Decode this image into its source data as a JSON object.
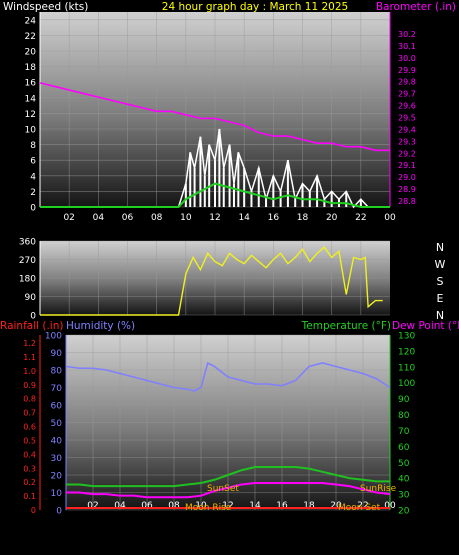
{
  "header": {
    "windspeed_label": "Windspeed (kts)",
    "title": "24 hour graph day : March 11 2025",
    "barometer_label": "Barometer (.in)"
  },
  "lower_header": {
    "rainfall_label": "Rainfall (.in)",
    "humidity_label": "Humidity (%)",
    "temperature_label": "Temperature (°F)",
    "dewpoint_label": "Dew Point (°F)"
  },
  "colors": {
    "windspeed": "#ffffff",
    "wind_avg": "#20d020",
    "barometer": "#ff00ff",
    "direction": "#f0f020",
    "humidity": "#8080ff",
    "temperature": "#20c020",
    "dewpoint": "#ff00ff",
    "rainfall": "#ff2020",
    "title": "#ffff00",
    "sun_moon": "#f0b000"
  },
  "x_ticks": [
    "02",
    "04",
    "06",
    "08",
    "10",
    "12",
    "14",
    "16",
    "18",
    "20",
    "22",
    "00"
  ],
  "compass_labels": [
    "N",
    "W",
    "S",
    "E",
    "N"
  ],
  "events": {
    "sunset": "SunSet",
    "sunrise": "SunRise",
    "moonrise": "Moon Rise",
    "moonset": "Moon Set"
  },
  "chart_data": [
    {
      "type": "line",
      "title": "24 hour graph day : March 11 2025",
      "xlim": [
        0,
        24
      ],
      "ylabel": "Windspeed (kts)",
      "ylim": [
        0,
        25
      ],
      "y_ticks": [
        0,
        2,
        4,
        6,
        8,
        10,
        12,
        14,
        16,
        18,
        20,
        22,
        24
      ],
      "y2label": "Barometer (.in)",
      "y2lim": [
        29.75,
        30.3
      ],
      "y2_ticks": [
        "28.8",
        "28.9",
        "29.0",
        "29.1",
        "29.2",
        "29.3",
        "29.4",
        "29.5",
        "29.6",
        "29.7",
        "29.8",
        "29.9",
        "30.0",
        "30.1",
        "30.2"
      ],
      "series": [
        {
          "name": "Barometer",
          "axis": "y2",
          "x": [
            0,
            1,
            2,
            3,
            4,
            5,
            6,
            7,
            8,
            9,
            10,
            11,
            12,
            13,
            14,
            15,
            16,
            17,
            18,
            19,
            20,
            21,
            22,
            23,
            24
          ],
          "values": [
            30.1,
            30.09,
            30.08,
            30.07,
            30.06,
            30.05,
            30.04,
            30.03,
            30.02,
            30.02,
            30.01,
            30.0,
            30.0,
            29.99,
            29.98,
            29.96,
            29.95,
            29.95,
            29.94,
            29.93,
            29.93,
            29.92,
            29.92,
            29.91,
            29.91
          ]
        },
        {
          "name": "Windspeed",
          "axis": "y",
          "x": [
            0,
            1,
            2,
            3,
            4,
            5,
            6,
            7,
            8,
            9,
            9.5,
            10,
            10.3,
            10.6,
            11,
            11.3,
            11.6,
            12,
            12.3,
            12.6,
            13,
            13.3,
            13.6,
            14,
            14.5,
            15,
            15.5,
            16,
            16.5,
            17,
            17.5,
            18,
            18.5,
            19,
            19.5,
            20,
            20.5,
            21,
            21.5,
            22,
            22.5,
            23,
            24
          ],
          "values": [
            0,
            0,
            0,
            0,
            0,
            0,
            0,
            0,
            0,
            0,
            0,
            3,
            7,
            5,
            9,
            4,
            8,
            6,
            10,
            5,
            8,
            3,
            7,
            5,
            2,
            5,
            1,
            4,
            2,
            6,
            1,
            3,
            2,
            4,
            1,
            2,
            1,
            2,
            0,
            1,
            0,
            0,
            0
          ]
        },
        {
          "name": "Average",
          "axis": "y",
          "x": [
            0,
            9.5,
            10,
            11,
            12,
            13,
            14,
            15,
            16,
            17,
            18,
            19,
            20,
            21,
            22,
            23,
            24
          ],
          "values": [
            0,
            0,
            1,
            2,
            3,
            2.5,
            2,
            1.5,
            1,
            1.5,
            1,
            1,
            0.5,
            0.5,
            0,
            0,
            0
          ]
        }
      ]
    },
    {
      "type": "scatter",
      "xlim": [
        0,
        24
      ],
      "ylim": [
        0,
        360
      ],
      "y_ticks": [
        0,
        90,
        180,
        270,
        360
      ],
      "series": [
        {
          "name": "Wind Direction",
          "x": [
            0,
            9,
            9.5,
            10,
            10.5,
            11,
            11.5,
            12,
            12.5,
            13,
            13.5,
            14,
            14.5,
            15,
            15.5,
            16,
            16.5,
            17,
            17.5,
            18,
            18.5,
            19,
            19.5,
            20,
            20.5,
            21,
            21.5,
            22,
            22.3,
            22.5,
            23,
            23.5
          ],
          "values": [
            0,
            0,
            0,
            200,
            280,
            220,
            300,
            260,
            240,
            300,
            270,
            250,
            290,
            260,
            230,
            270,
            300,
            250,
            280,
            320,
            260,
            300,
            330,
            280,
            310,
            100,
            280,
            270,
            280,
            40,
            70,
            70
          ]
        }
      ]
    },
    {
      "type": "line",
      "xlim": [
        0,
        24
      ],
      "y_left_outer_label": "Rainfall (.in)",
      "y_left_outer_ticks": [
        "0",
        "0.1",
        "0.2",
        "0.3",
        "0.4",
        "0.5",
        "0.6",
        "0.7",
        "0.8",
        "0.9",
        "1.0",
        "1.1",
        "1.2"
      ],
      "y_left_inner_label": "Humidity (%)",
      "ylim": [
        0,
        100
      ],
      "y_ticks": [
        0,
        10,
        20,
        30,
        40,
        50,
        60,
        70,
        80,
        90,
        100
      ],
      "y2label": "Temperature (°F)",
      "y2lim": [
        20,
        130
      ],
      "y2_ticks": [
        20,
        30,
        40,
        50,
        60,
        70,
        80,
        90,
        100,
        110,
        120,
        130
      ],
      "series": [
        {
          "name": "Humidity",
          "axis": "y",
          "x": [
            0,
            1,
            2,
            3,
            4,
            5,
            6,
            7,
            8,
            9,
            9.5,
            10,
            10.5,
            11,
            12,
            13,
            14,
            15,
            16,
            17,
            18,
            19,
            20,
            21,
            22,
            23,
            24
          ],
          "values": [
            82,
            81,
            81,
            80,
            78,
            76,
            74,
            72,
            70,
            69,
            68,
            70,
            84,
            82,
            76,
            74,
            72,
            72,
            71,
            74,
            82,
            84,
            82,
            80,
            78,
            75,
            70
          ]
        },
        {
          "name": "Temperature",
          "axis": "y2",
          "x": [
            0,
            1,
            2,
            3,
            4,
            5,
            6,
            7,
            8,
            9,
            10,
            11,
            12,
            13,
            14,
            15,
            16,
            17,
            18,
            19,
            20,
            21,
            22,
            23,
            24
          ],
          "values": [
            36,
            36,
            35,
            35,
            35,
            35,
            35,
            35,
            35,
            36,
            37,
            39,
            42,
            45,
            47,
            47,
            47,
            47,
            46,
            44,
            42,
            40,
            39,
            38,
            38
          ]
        },
        {
          "name": "Dew Point",
          "axis": "y2",
          "x": [
            0,
            1,
            2,
            3,
            4,
            5,
            6,
            7,
            8,
            9,
            10,
            11,
            12,
            13,
            14,
            15,
            16,
            17,
            18,
            19,
            20,
            21,
            22,
            23,
            24
          ],
          "values": [
            31,
            31,
            30,
            30,
            29,
            29,
            28,
            28,
            28,
            28,
            29,
            32,
            34,
            36,
            37,
            37,
            37,
            37,
            37,
            37,
            36,
            35,
            33,
            31,
            30
          ]
        },
        {
          "name": "Rainfall",
          "axis": "rain",
          "x": [
            0,
            24
          ],
          "values": [
            0,
            0
          ]
        }
      ]
    }
  ]
}
